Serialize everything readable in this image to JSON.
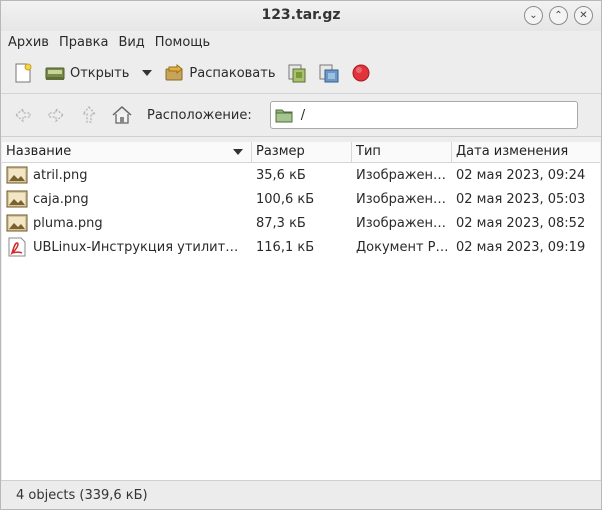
{
  "window": {
    "title": "123.tar.gz"
  },
  "menubar": {
    "items": [
      "Архив",
      "Правка",
      "Вид",
      "Помощь"
    ]
  },
  "toolbar": {
    "open_label": "Открыть",
    "extract_label": "Распаковать"
  },
  "location": {
    "label": "Расположение:",
    "path": "/"
  },
  "columns": [
    "Название",
    "Размер",
    "Тип",
    "Дата изменения"
  ],
  "files": [
    {
      "name": "atril.png",
      "size": "35,6 кБ",
      "type": "Изображен…",
      "date": "02 мая 2023, 09:24",
      "icon": "image-file-icon"
    },
    {
      "name": "caja.png",
      "size": "100,6 кБ",
      "type": "Изображен…",
      "date": "02 мая 2023, 05:03",
      "icon": "image-file-icon"
    },
    {
      "name": "pluma.png",
      "size": "87,3 кБ",
      "type": "Изображен…",
      "date": "02 мая 2023, 08:52",
      "icon": "image-file-icon"
    },
    {
      "name": "UBLinux-Инструкция утилит…",
      "size": "116,1 кБ",
      "type": "Документ P…",
      "date": "02 мая 2023, 09:19",
      "icon": "pdf-file-icon"
    }
  ],
  "status": {
    "text": "4 objects (339,6 кБ)"
  },
  "colors": {
    "stop": "#e0343a",
    "folder": "#8fb07a",
    "window_bg": "#ededed"
  }
}
